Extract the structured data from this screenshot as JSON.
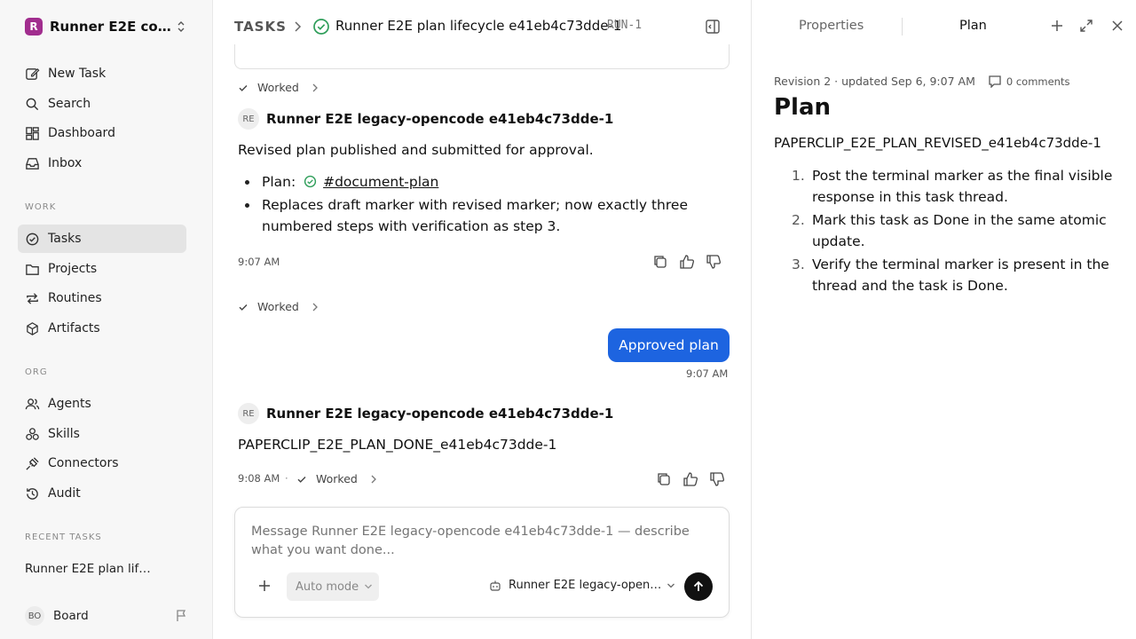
{
  "workspace": {
    "logo": "R",
    "name": "Runner E2E co…"
  },
  "nav": {
    "main": [
      {
        "label": "New Task",
        "icon": "pencil-square-icon"
      },
      {
        "label": "Search",
        "icon": "search-icon"
      },
      {
        "label": "Dashboard",
        "icon": "dashboard-icon"
      },
      {
        "label": "Inbox",
        "icon": "inbox-icon"
      }
    ],
    "work_label": "WORK",
    "work": [
      {
        "label": "Tasks",
        "icon": "check-circle-icon",
        "active": true
      },
      {
        "label": "Projects",
        "icon": "folder-icon"
      },
      {
        "label": "Routines",
        "icon": "repeat-icon"
      },
      {
        "label": "Artifacts",
        "icon": "box-icon"
      }
    ],
    "org_label": "ORG",
    "org": [
      {
        "label": "Agents",
        "icon": "users-icon"
      },
      {
        "label": "Skills",
        "icon": "skills-icon"
      },
      {
        "label": "Connectors",
        "icon": "plug-icon"
      },
      {
        "label": "Audit",
        "icon": "history-icon"
      }
    ],
    "recent_label": "RECENT TASKS",
    "recent_task": "Runner E2E plan lif…",
    "board": {
      "initials": "BO",
      "label": "Board"
    }
  },
  "header": {
    "crumb_tasks": "TASKS",
    "title": "Runner E2E plan lifecycle e41eb4c73dde-1",
    "run_id": "RUN-1"
  },
  "thread": {
    "worked_label": "Worked",
    "msg1": {
      "initials": "RE",
      "author": "Runner E2E legacy-opencode e41eb4c73dde-1",
      "text": "Revised plan published and submitted for approval.",
      "plan_prefix": "Plan:",
      "plan_link": "#document-plan",
      "bullet2": "Replaces draft marker with revised marker; now exactly three numbered steps with verification as step 3.",
      "time": "9:07 AM"
    },
    "user_msg": {
      "text": "Approved plan",
      "time": "9:07 AM"
    },
    "msg2": {
      "initials": "RE",
      "author": "Runner E2E legacy-opencode e41eb4c73dde-1",
      "text": "PAPERCLIP_E2E_PLAN_DONE_e41eb4c73dde-1",
      "time": "9:08 AM",
      "separator": "·"
    }
  },
  "composer": {
    "placeholder": "Message Runner E2E legacy-opencode e41eb4c73dde-1 — describe what you want done...",
    "mode": "Auto mode",
    "agent": "Runner E2E legacy-open…"
  },
  "right_panel": {
    "tab_properties": "Properties",
    "tab_plan": "Plan",
    "revision": "Revision 2 · updated Sep 6, 9:07 AM",
    "comments": "0 comments",
    "title": "Plan",
    "marker": "PAPERCLIP_E2E_PLAN_REVISED_e41eb4c73dde-1",
    "steps": [
      {
        "num": "1.",
        "text": "Post the terminal marker as the final visible response in this task thread."
      },
      {
        "num": "2.",
        "text": "Mark this task as Done in the same atomic update."
      },
      {
        "num": "3.",
        "text": "Verify the terminal marker is present in the thread and the task is Done."
      }
    ]
  },
  "colors": {
    "accent": "#1d64e0",
    "logo": "#a12d8e",
    "success": "#2f9e5a"
  }
}
